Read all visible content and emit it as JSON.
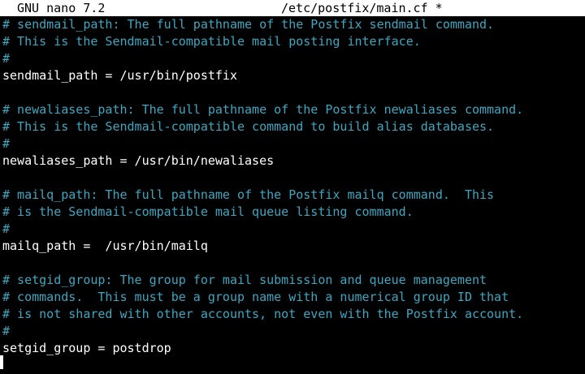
{
  "header": {
    "app_name": "GNU nano 7.2",
    "file_name": "/etc/postfix/main.cf *"
  },
  "lines": [
    {
      "type": "comment",
      "text": "# sendmail_path: The full pathname of the Postfix sendmail command."
    },
    {
      "type": "comment",
      "text": "# This is the Sendmail-compatible mail posting interface."
    },
    {
      "type": "comment",
      "text": "#"
    },
    {
      "type": "code",
      "text": "sendmail_path = /usr/bin/postfix"
    },
    {
      "type": "blank",
      "text": ""
    },
    {
      "type": "comment",
      "text": "# newaliases_path: The full pathname of the Postfix newaliases command."
    },
    {
      "type": "comment",
      "text": "# This is the Sendmail-compatible command to build alias databases."
    },
    {
      "type": "comment",
      "text": "#"
    },
    {
      "type": "code",
      "text": "newaliases_path = /usr/bin/newaliases"
    },
    {
      "type": "blank",
      "text": ""
    },
    {
      "type": "comment",
      "text": "# mailq_path: The full pathname of the Postfix mailq command.  This"
    },
    {
      "type": "comment",
      "text": "# is the Sendmail-compatible mail queue listing command."
    },
    {
      "type": "comment",
      "text": "#"
    },
    {
      "type": "code",
      "text": "mailq_path =  /usr/bin/mailq"
    },
    {
      "type": "blank",
      "text": ""
    },
    {
      "type": "comment",
      "text": "# setgid_group: The group for mail submission and queue management"
    },
    {
      "type": "comment",
      "text": "# commands.  This must be a group name with a numerical group ID that"
    },
    {
      "type": "comment",
      "text": "# is not shared with other accounts, not even with the Postfix account."
    },
    {
      "type": "comment",
      "text": "#"
    },
    {
      "type": "code",
      "text": "setgid_group = postdrop"
    },
    {
      "type": "blank",
      "text": ""
    }
  ],
  "colors": {
    "comment": "#3aa8c1",
    "code": "#ffffff",
    "background": "#000000",
    "titlebar_bg": "#ffffff",
    "titlebar_fg": "#000000"
  }
}
